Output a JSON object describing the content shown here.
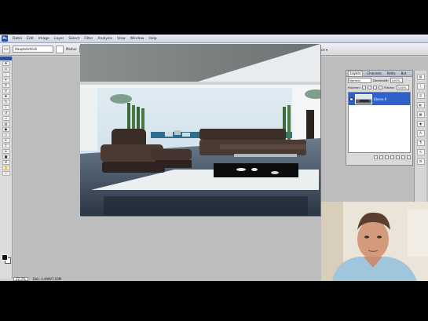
{
  "app": {
    "logo_text": "Ps"
  },
  "menu": {
    "items": [
      "Datei",
      "Edit",
      "Image",
      "Layer",
      "Select",
      "Filter",
      "Analysis",
      "View",
      "Window",
      "Help"
    ]
  },
  "options": {
    "tool_preset": "Hauptsächlich",
    "mode_label": "Modus:",
    "mode_value": "Normal",
    "width_label": "Breite:",
    "width_value": "",
    "height_label": "Höhe:",
    "height_value": "",
    "info_text": "200 mit das 2010 wollständig 17 Alle prüfen",
    "workspace_label": "Workspace ▾"
  },
  "status": {
    "zoom": "22,3%",
    "doc_info": "Dok: 3,49M/7,03M"
  },
  "layers_panel": {
    "tabs": [
      "Layers",
      "Channels",
      "Paths",
      "Bot"
    ],
    "active_tab": 0,
    "blend_mode": "Normal",
    "opacity_label": "Deckkraft:",
    "opacity_value": "100%",
    "fill_label": "Fläche:",
    "fill_value": "100%",
    "lock_label": "Fixieren:",
    "layers": [
      {
        "name": "Ebene 0",
        "selected": true
      }
    ]
  },
  "colors": {
    "accent": "#2f62c9",
    "menubar": "#cbd3e4",
    "workspace": "#bdbdbd"
  },
  "icons": {
    "tools": [
      "move-icon",
      "marquee-icon",
      "lasso-icon",
      "magic-wand-icon",
      "crop-icon",
      "eyedropper-icon",
      "healing-brush-icon",
      "brush-icon",
      "clone-stamp-icon",
      "history-brush-icon",
      "eraser-icon",
      "gradient-icon",
      "blur-icon",
      "dodge-icon",
      "pen-icon",
      "type-icon",
      "path-select-icon",
      "shape-icon",
      "notes-icon",
      "hand-icon",
      "zoom-icon"
    ],
    "dock": [
      "histogram-icon",
      "info-icon",
      "navigator-icon",
      "color-icon",
      "swatches-icon",
      "styles-icon",
      "character-icon",
      "paragraph-icon",
      "brushes-icon",
      "tool-presets-icon"
    ]
  }
}
